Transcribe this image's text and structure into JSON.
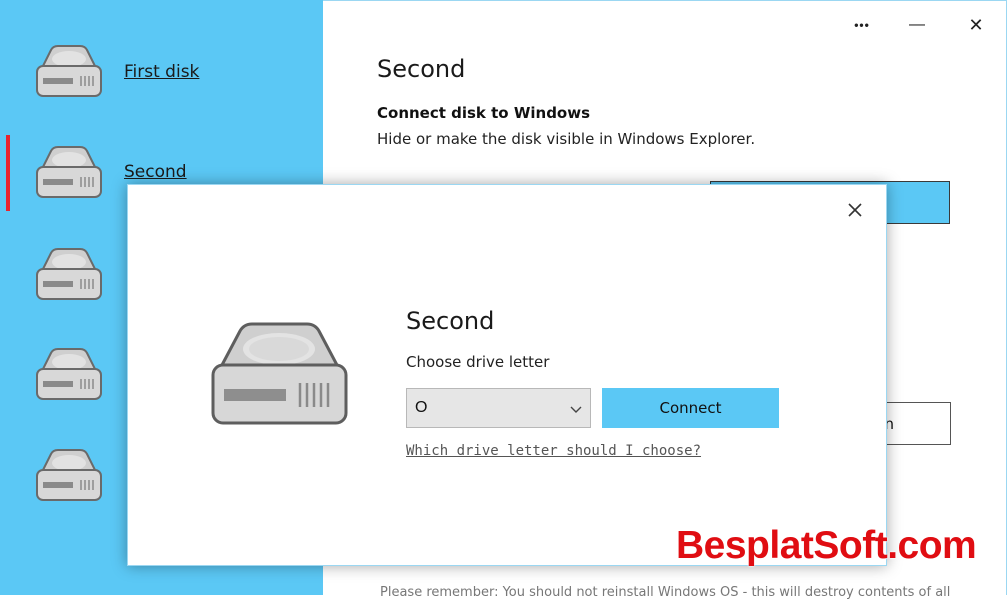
{
  "sidebar": {
    "items": [
      {
        "label": "First disk",
        "selected": false
      },
      {
        "label": "Second",
        "selected": true
      },
      {
        "label": "",
        "selected": false
      },
      {
        "label": "",
        "selected": false
      },
      {
        "label": "",
        "selected": false
      }
    ],
    "accent_color": "#5bc8f5",
    "selection_color": "#e8242e"
  },
  "titlebar": {
    "more_glyph": "•••",
    "minimize_glyph": "—",
    "close_glyph": "✕"
  },
  "main": {
    "title": "Second",
    "section_heading": "Connect disk to Windows",
    "section_desc": "Hide or make the disk visible in Windows Explorer.",
    "partial_button_text": "n",
    "footer_note": "Please remember: You should not reinstall Windows OS - this will destroy contents of all"
  },
  "dialog": {
    "title": "Second",
    "choose_label": "Choose drive letter",
    "drive_letter": "O",
    "connect_label": "Connect",
    "help_link": "Which drive letter should I choose?",
    "close_glyph": "✕"
  },
  "watermark": "BesplatSoft.com",
  "icons": {
    "disk": "hard-drive-icon",
    "chevron": "chevron-down-icon"
  }
}
